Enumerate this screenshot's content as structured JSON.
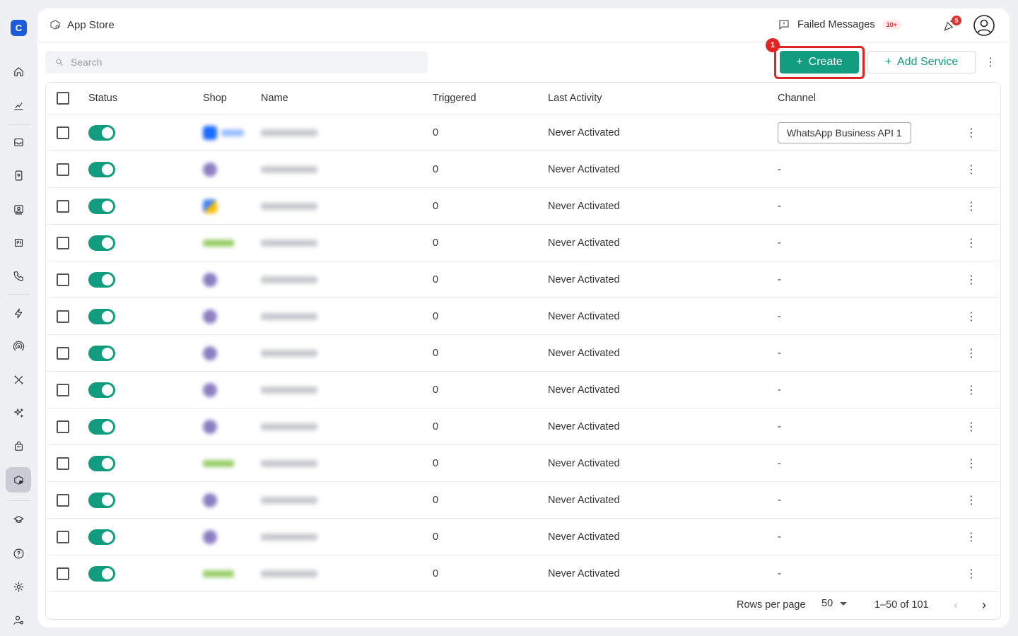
{
  "header": {
    "breadcrumb": "App Store",
    "failed_messages_label": "Failed Messages",
    "failed_messages_count": "10+",
    "notification_count": "5"
  },
  "toolbar": {
    "search_placeholder": "Search",
    "create_label": "Create",
    "add_service_label": "Add Service",
    "annotation_badge": "1"
  },
  "table": {
    "columns": [
      "Status",
      "Shop",
      "Name",
      "Triggered",
      "Last Activity",
      "Channel"
    ],
    "rows": [
      {
        "triggered": "0",
        "last_activity": "Never Activated",
        "channel": "WhatsApp Business API 1",
        "shop_style": "blue"
      },
      {
        "triggered": "0",
        "last_activity": "Never Activated",
        "channel": "-",
        "shop_style": "purple"
      },
      {
        "triggered": "0",
        "last_activity": "Never Activated",
        "channel": "-",
        "shop_style": "google"
      },
      {
        "triggered": "0",
        "last_activity": "Never Activated",
        "channel": "-",
        "shop_style": "green"
      },
      {
        "triggered": "0",
        "last_activity": "Never Activated",
        "channel": "-",
        "shop_style": "purple"
      },
      {
        "triggered": "0",
        "last_activity": "Never Activated",
        "channel": "-",
        "shop_style": "purple"
      },
      {
        "triggered": "0",
        "last_activity": "Never Activated",
        "channel": "-",
        "shop_style": "purple"
      },
      {
        "triggered": "0",
        "last_activity": "Never Activated",
        "channel": "-",
        "shop_style": "purple"
      },
      {
        "triggered": "0",
        "last_activity": "Never Activated",
        "channel": "-",
        "shop_style": "purple"
      },
      {
        "triggered": "0",
        "last_activity": "Never Activated",
        "channel": "-",
        "shop_style": "green"
      },
      {
        "triggered": "0",
        "last_activity": "Never Activated",
        "channel": "-",
        "shop_style": "purple"
      },
      {
        "triggered": "0",
        "last_activity": "Never Activated",
        "channel": "-",
        "shop_style": "purple"
      },
      {
        "triggered": "0",
        "last_activity": "Never Activated",
        "channel": "-",
        "shop_style": "green"
      }
    ]
  },
  "footer": {
    "rows_per_page_label": "Rows per page",
    "rows_per_page_value": "50",
    "range": "1–50 of 101"
  },
  "colors": {
    "accent": "#119c7f",
    "highlight": "#e02424",
    "brand": "#1e5bd9"
  },
  "nav_icons": [
    "home-icon",
    "analytics-icon",
    "inbox-icon",
    "contact-card-icon",
    "contacts-icon",
    "board-icon",
    "phone-icon",
    "automation-icon",
    "broadcast-icon",
    "tools-icon",
    "ai-sparkle-icon",
    "shop-bag-icon",
    "app-store-icon",
    "academy-icon",
    "help-icon",
    "settings-icon",
    "user-settings-icon"
  ]
}
